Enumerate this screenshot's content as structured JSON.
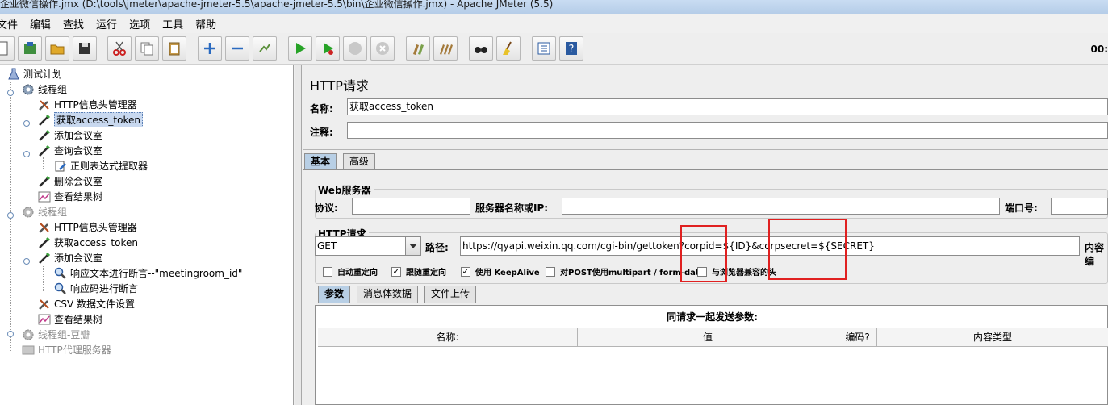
{
  "window": {
    "title": "企业微信操作.jmx (D:\\tools\\jmeter\\apache-jmeter-5.5\\apache-jmeter-5.5\\bin\\企业微信操作.jmx) - Apache JMeter (5.5)"
  },
  "menu": [
    "文件",
    "编辑",
    "查找",
    "运行",
    "选项",
    "工具",
    "帮助"
  ],
  "toolbar": {
    "timer": "00:"
  },
  "tree": {
    "nodes": [
      {
        "label": "测试计划"
      },
      {
        "label": "线程组"
      },
      {
        "label": "HTTP信息头管理器"
      },
      {
        "label": "获取access_token"
      },
      {
        "label": "添加会议室"
      },
      {
        "label": "查询会议室"
      },
      {
        "label": "正则表达式提取器"
      },
      {
        "label": "删除会议室"
      },
      {
        "label": "查看结果树"
      },
      {
        "label": "线程组"
      },
      {
        "label": "HTTP信息头管理器"
      },
      {
        "label": "获取access_token"
      },
      {
        "label": "添加会议室"
      },
      {
        "label": "响应文本进行断言--\"meetingroom_id\""
      },
      {
        "label": "响应码进行断言"
      },
      {
        "label": "CSV 数据文件设置"
      },
      {
        "label": "查看结果树"
      },
      {
        "label": "线程组-豆瓣"
      },
      {
        "label": "HTTP代理服务器"
      }
    ]
  },
  "panel": {
    "title": "HTTP请求",
    "name_label": "名称:",
    "name_value": "获取access_token",
    "comment_label": "注释:",
    "tabs": [
      "基本",
      "高级"
    ],
    "web_server": {
      "title": "Web服务器",
      "protocol_label": "协议:",
      "server_label": "服务器名称或IP:",
      "port_label": "端口号:"
    },
    "http_request": {
      "title": "HTTP请求",
      "method": "GET",
      "path_label": "路径:",
      "path_value": "https://qyapi.weixin.qq.com/cgi-bin/gettoken?corpid=${ID}&corpsecret=${SECRET}",
      "encoding_label": "内容编",
      "checkboxes": [
        {
          "label": "自动重定向",
          "checked": false
        },
        {
          "label": "跟随重定向",
          "checked": true
        },
        {
          "label": "使用 KeepAlive",
          "checked": true
        },
        {
          "label": "对POST使用multipart / form-data",
          "checked": false
        },
        {
          "label": "与浏览器兼容的头",
          "checked": false
        }
      ]
    },
    "param_tabs": [
      "参数",
      "消息体数据",
      "文件上传"
    ],
    "params": {
      "caption": "同请求一起发送参数:",
      "columns": [
        "名称:",
        "值",
        "编码?",
        "内容类型"
      ]
    }
  }
}
